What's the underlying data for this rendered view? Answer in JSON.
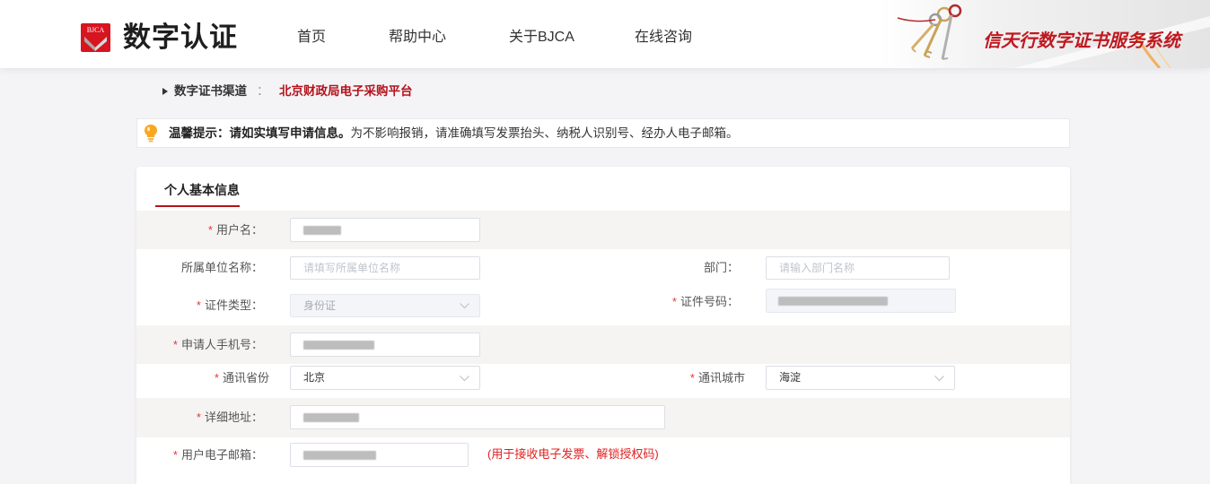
{
  "header": {
    "logo_badge": "BJCA",
    "logo_text": "数字认证",
    "nav": [
      "首页",
      "帮助中心",
      "关于BJCA",
      "在线咨询"
    ],
    "system_title": "信天行数字证书服务系统"
  },
  "breadcrumb": {
    "channel_label": "数字证书渠道",
    "separator": "：",
    "platform": "北京财政局电子采购平台"
  },
  "tip": {
    "title": "温馨提示：请如实填写申请信息。",
    "message": "为不影响报销，请准确填写发票抬头、纳税人识别号、经办人电子邮箱。"
  },
  "tabs": [
    {
      "label": "个人基本信息",
      "active": true
    }
  ],
  "form": {
    "required_mark": "*",
    "username": {
      "label": "用户名："
    },
    "org": {
      "label": "所属单位名称：",
      "placeholder": "请填写所属单位名称"
    },
    "dept": {
      "label": "部门：",
      "placeholder": "请输入部门名称"
    },
    "id_type": {
      "label": "证件类型：",
      "value": "身份证"
    },
    "id_number": {
      "label": "证件号码："
    },
    "phone": {
      "label": "申请人手机号："
    },
    "province": {
      "label": "通讯省份",
      "value": "北京"
    },
    "city": {
      "label": "通讯城市",
      "value": "海淀"
    },
    "address": {
      "label": "详细地址："
    },
    "email": {
      "label": "用户电子邮箱：",
      "hint": "(用于接收电子发票、解锁授权码)"
    }
  },
  "icons": {
    "breadcrumb": "caret-right-icon",
    "tip": "lightbulb-icon",
    "select": "chevron-down-icon",
    "header_art": "keys-icon"
  },
  "colors": {
    "brand_red": "#d7141f",
    "accent_red": "#b5121b",
    "required_mark": "#e4393c",
    "hint_text": "#e02020",
    "row_alt_bg": "#f5f4f2",
    "page_bg": "#f4f4f7",
    "tip_icon": "#f7a823"
  }
}
